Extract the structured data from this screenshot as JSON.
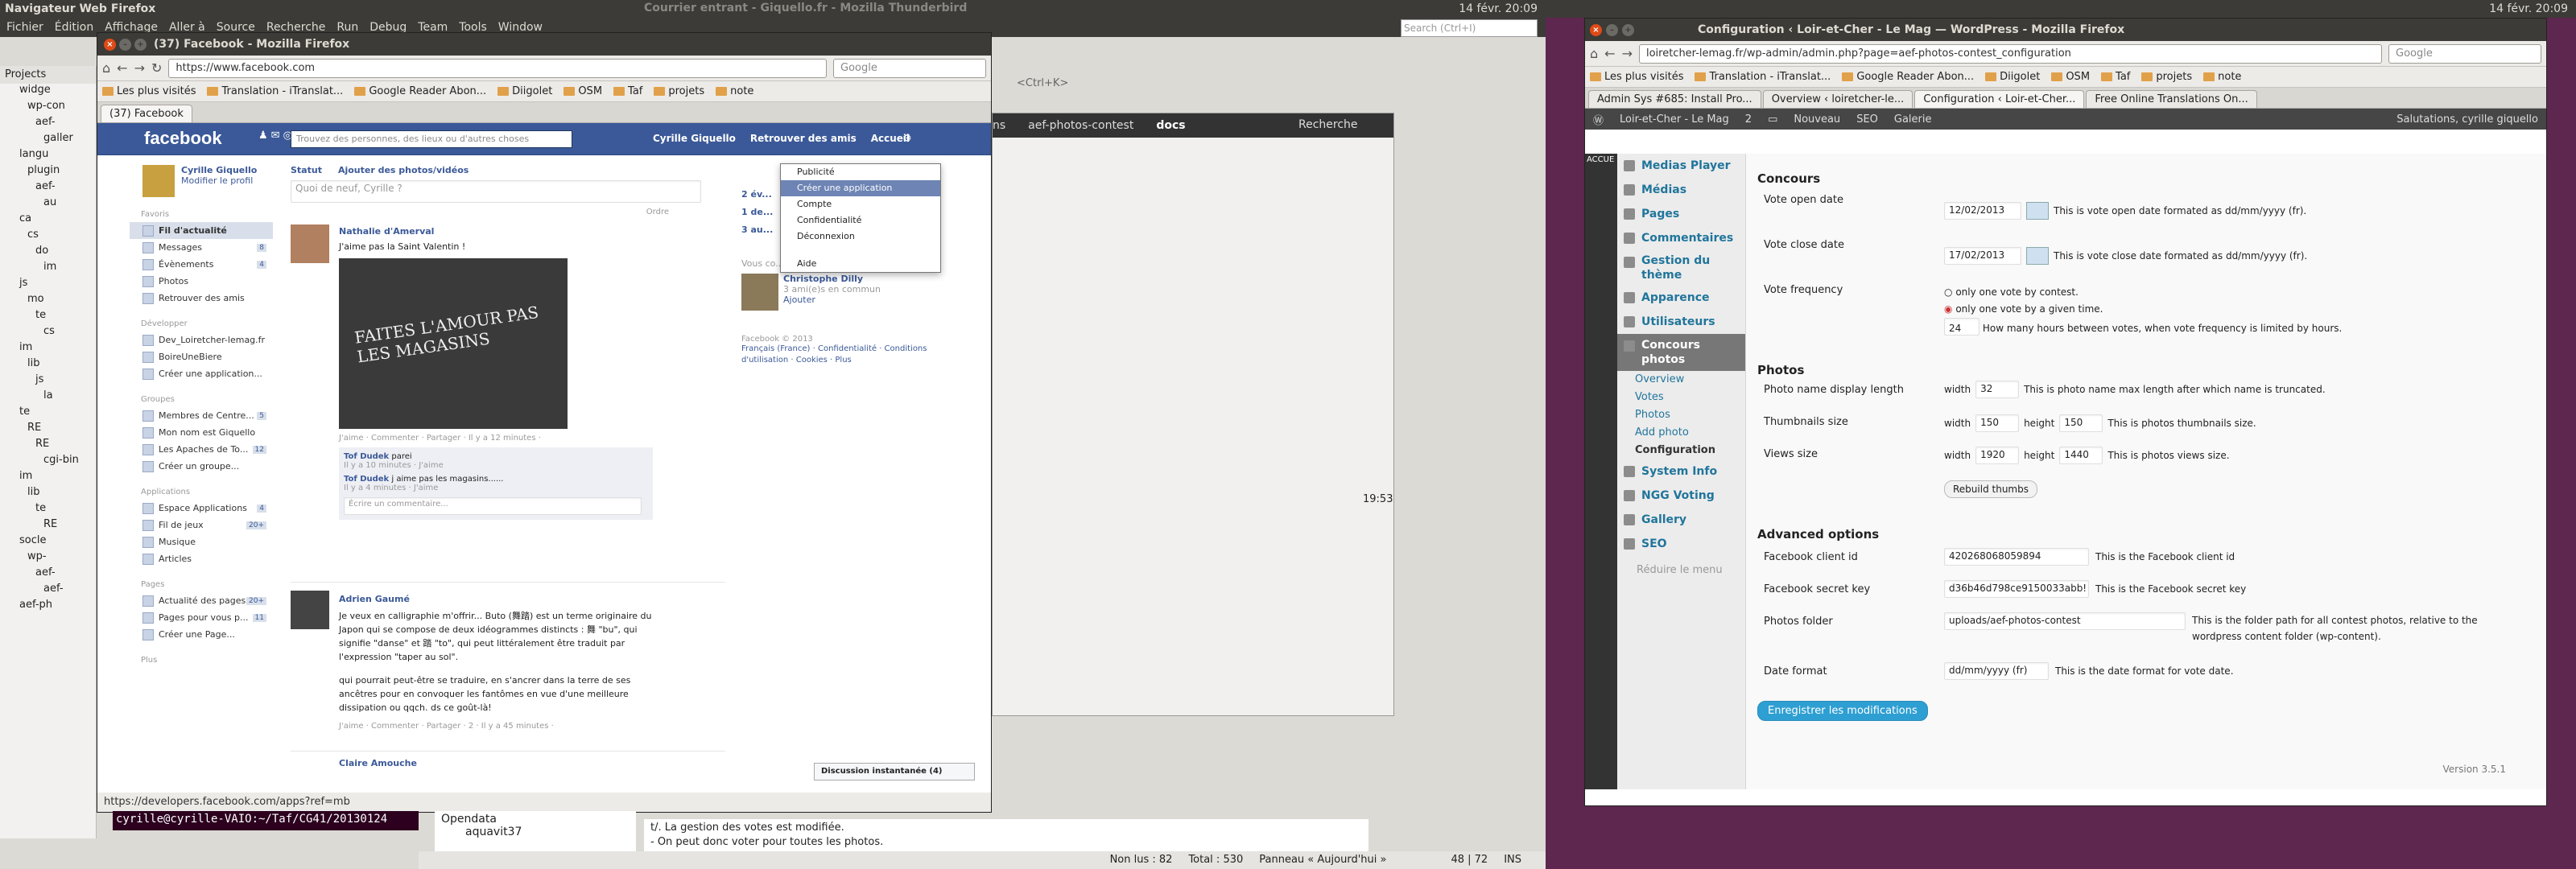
{
  "left_panel": {
    "title": "Navigateur Web Firefox",
    "menu": [
      "Fichier",
      "Édition",
      "Affichage",
      "Aller à",
      "Source",
      "Recherche",
      "Run",
      "Debug",
      "Team",
      "Tools",
      "Window"
    ],
    "bg_title": "Courrier entrant - Giquello.fr - Mozilla Thunderbird",
    "clock": "14 févr. 20:09",
    "projects_tab": "Projects",
    "tree_items": [
      "widge",
      "wp-con",
      "aef-",
      "galler",
      "langu",
      "plugin",
      "aef-",
      "au",
      "ca",
      "cs",
      "do",
      "im",
      "js",
      "mo",
      "te",
      "cs",
      "im",
      "lib",
      "js",
      "la",
      "te",
      "RE",
      "RE",
      "cgi-bin",
      "im",
      "lib",
      "te",
      "RE",
      "socle",
      "wp-",
      "aef-",
      "aef-",
      "aef-ph"
    ],
    "search_placeholder": "Search (Ctrl+I)"
  },
  "facebook_window": {
    "title": "(37) Facebook - Mozilla Firefox",
    "url": "https://www.facebook.com",
    "search_placeholder": "Google",
    "bookmarks": [
      "Les plus visités",
      "Translation - iTranslat...",
      "Google Reader Abon...",
      "Diigolet",
      "OSM",
      "Taf",
      "projets",
      "note"
    ],
    "tab": "(37) Facebook",
    "fb_search_placeholder": "Trouvez des personnes, des lieux ou d'autres choses",
    "user": "Cyrille Giquello",
    "top_links": [
      "Cyrille Giquello",
      "Retrouver des amis",
      "Accueil"
    ],
    "profile_edit": "Modifier le profil",
    "sections": {
      "fav": "Favoris",
      "dev": "Développer",
      "groups": "Groupes",
      "apps": "Applications",
      "pages": "Pages",
      "more": "Plus"
    },
    "fav_items": [
      {
        "l": "Fil d'actualité",
        "c": ""
      },
      {
        "l": "Messages",
        "c": "8"
      },
      {
        "l": "Évènements",
        "c": "4"
      },
      {
        "l": "Photos",
        "c": ""
      },
      {
        "l": "Retrouver des amis",
        "c": ""
      }
    ],
    "dev_items": [
      "Dev_Loiretcher-lemag.fr",
      "BoireUneBiere",
      "Créer une application..."
    ],
    "group_items": [
      {
        "l": "Membres de Centre...",
        "c": "5"
      },
      {
        "l": "Mon nom est Giquello",
        "c": ""
      },
      {
        "l": "Les Apaches de To...",
        "c": "12"
      },
      {
        "l": "Créer un groupe...",
        "c": ""
      }
    ],
    "app_items": [
      {
        "l": "Espace Applications",
        "c": "4"
      },
      {
        "l": "Fil de jeux",
        "c": "20+"
      },
      {
        "l": "Musique",
        "c": ""
      },
      {
        "l": "Articles",
        "c": ""
      }
    ],
    "page_items": [
      {
        "l": "Actualité des pages",
        "c": "20+"
      },
      {
        "l": "Pages pour vous p...",
        "c": "11"
      },
      {
        "l": "Créer une Page...",
        "c": ""
      }
    ],
    "status_tab": "Statut",
    "photo_tab": "Ajouter des photos/vidéos",
    "status_placeholder": "Quoi de neuf, Cyrille ?",
    "order": "Ordre",
    "post1": {
      "author": "Nathalie d'Amerval",
      "text": "J'aime pas la Saint Valentin !",
      "photo_text": "FAITES L'AMOUR PAS LES MAGASINS",
      "actions": "J'aime · Commenter · Partager · Il y a 12 minutes ·",
      "c1_author": "Tof Dudek",
      "c1_text": "parei",
      "c1_meta": "Il y a 10 minutes · J'aime",
      "c2_author": "Tof Dudek",
      "c2_text": "j aime pas les magasins......",
      "c2_meta": "Il y a 4 minutes · J'aime",
      "comment_placeholder": "Écrire un commentaire..."
    },
    "post2": {
      "author": "Adrien Gaumé",
      "p1": "Je veux en calligraphie m'offrir... Buto (舞踏) est un terme originaire du Japon qui se compose de deux idéogrammes distincts : 舞 \"bu\", qui signifie \"danse\" et 踏 \"to\", qui peut littéralement être traduit par l'expression \"taper au sol\".",
      "p2": "qui pourrait peut-être se traduire, en s'ancrer dans la terre de ses ancêtres pour en convoquer les fantômes en vue d'une meilleure dissipation ou qqch. ds ce goût-là!",
      "actions": "J'aime · Commenter · Partager · 2 · Il y a 45 minutes ·"
    },
    "post3_author": "Claire Amouche",
    "right_col": {
      "events": [
        "2 év...",
        "1 de...",
        "3 au..."
      ],
      "know": "Vous co...",
      "person": "Christophe Dilly",
      "mutual": "3 ami(e)s en commun",
      "add": "Ajouter",
      "copyright": "Facebook © 2013",
      "footer": "Français (France) · Confidentialité · Conditions d'utilisation · Cookies · Plus"
    },
    "dropdown": [
      "Publicité",
      "Créer une application",
      "Compte",
      "Confidentialité",
      "Déconnexion",
      "Aide"
    ],
    "chat": "Discussion instantanée (4)",
    "status_url": "https://developers.facebook.com/apps?ref=mb"
  },
  "terminal": {
    "prompt": "cyrille@cyrille-VAIO:~/Taf/CG41/20130124"
  },
  "thunderbird": {
    "tabs": [
      "ns",
      "aef-photos-contest",
      "docs"
    ],
    "search": "Recherche",
    "search_hint": "<Ctrl+K>",
    "folders": [
      "Opendata",
      "aquavit37"
    ],
    "preview_lines": [
      "t/. La gestion des votes est modifiée.",
      "- On peut donc voter pour toutes les photos."
    ],
    "time": "19:53",
    "unread": "Non lus : 82",
    "total": "Total : 530",
    "panel": "Panneau « Aujourd'hui »",
    "editor_pos": "48 | 72",
    "ins": "INS"
  },
  "right_panel": {
    "title": "Configuration ‹ Loir-et-Cher - Le Mag — WordPress - Mozilla Firefox",
    "clock": "14 févr. 20:09",
    "url": "loiretcher-lemag.fr/wp-admin/admin.php?page=aef-photos-contest_configuration",
    "search_placeholder": "Google",
    "bookmarks": [
      "Les plus visités",
      "Translation - iTranslat...",
      "Google Reader Abon...",
      "Diigolet",
      "OSM",
      "Taf",
      "projets",
      "note"
    ],
    "tabs": [
      "Admin Sys #685: Install Pro...",
      "Overview ‹ loiretcher-le...",
      "Configuration ‹ Loir-et-Cher...",
      "Free Online Translations On..."
    ],
    "adminbar": {
      "site": "Loir-et-Cher - Le Mag",
      "updates": "2",
      "new": "Nouveau",
      "seo": "SEO",
      "gallery": "Galerie",
      "greet": "Salutations, cyrille giquello"
    },
    "accueil": "ACCUE",
    "menu": [
      "Medias Player",
      "Médias",
      "Pages",
      "Commentaires",
      "Gestion du thème",
      "Apparence",
      "Utilisateurs",
      "Concours photos"
    ],
    "submenu": [
      "Overview",
      "Votes",
      "Photos",
      "Add photo",
      "Configuration"
    ],
    "menu2": [
      "System Info",
      "NGG Voting",
      "Gallery",
      "SEO"
    ],
    "collapse": "Réduire le menu",
    "sections": {
      "concours": "Concours",
      "photos": "Photos",
      "advanced": "Advanced options"
    },
    "fields": {
      "open_label": "Vote open date",
      "open_value": "12/02/2013",
      "open_help": "This is vote open date formated as dd/mm/yyyy (fr).",
      "close_label": "Vote close date",
      "close_value": "17/02/2013",
      "close_help": "This is vote close date formated as dd/mm/yyyy (fr).",
      "freq_label": "Vote frequency",
      "freq_opt1": "only one vote by contest.",
      "freq_opt2": "only one vote by a given time.",
      "freq_hours": "24",
      "freq_help": "How many hours between votes, when vote frequency is limited by hours.",
      "name_label": "Photo name display length",
      "width": "width",
      "name_value": "32",
      "name_help": "This is photo name max length after which name is truncated.",
      "thumb_label": "Thumbnails size",
      "thumb_w": "150",
      "height": "height",
      "thumb_h": "150",
      "thumb_help": "This is photos thumbnails size.",
      "views_label": "Views size",
      "views_w": "1920",
      "views_h": "1440",
      "views_help": "This is photos views size.",
      "rebuild": "Rebuild thumbs",
      "fbid_label": "Facebook client id",
      "fbid_value": "420268068059894",
      "fbid_help": "This is the Facebook client id",
      "fbsec_label": "Facebook secret key",
      "fbsec_value": "d36b46d798ce9150033abb!",
      "fbsec_help": "This is the Facebook secret key",
      "folder_label": "Photos folder",
      "folder_value": "uploads/aef-photos-contest",
      "folder_help": "This is the folder path for all contest photos, relative to the wordpress content folder (wp-content).",
      "date_label": "Date format",
      "date_value": "dd/mm/yyyy (fr)",
      "date_help": "This is the date format for vote date.",
      "save": "Enregistrer les modifications"
    },
    "version": "Version 3.5.1"
  }
}
